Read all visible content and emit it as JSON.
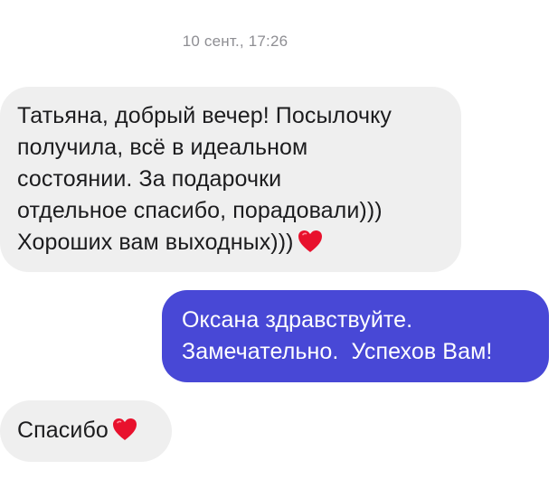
{
  "conversation": {
    "timestamp": "10 сент., 17:26",
    "messages": [
      {
        "direction": "incoming",
        "lines": [
          "Татьяна, добрый вечер! Посылочку",
          "получила, всё в идеальном",
          "состоянии. За подарочки",
          "отдельное спасибо, порадовали)))",
          "Хороших вам выходных)))"
        ],
        "trailing_icon": "red-heart-emoji"
      },
      {
        "direction": "outgoing",
        "lines": [
          "Оксана здравствуйте.",
          "Замечательно.  Успехов Вам!"
        ]
      },
      {
        "direction": "incoming",
        "lines": [
          "Спасибо"
        ],
        "trailing_icon": "red-heart-emoji"
      }
    ]
  },
  "colors": {
    "incoming_bubble": "#efefef",
    "outgoing_bubble": "#4848d6",
    "heart": "#e8112d",
    "timestamp_text": "#8e8e93"
  }
}
